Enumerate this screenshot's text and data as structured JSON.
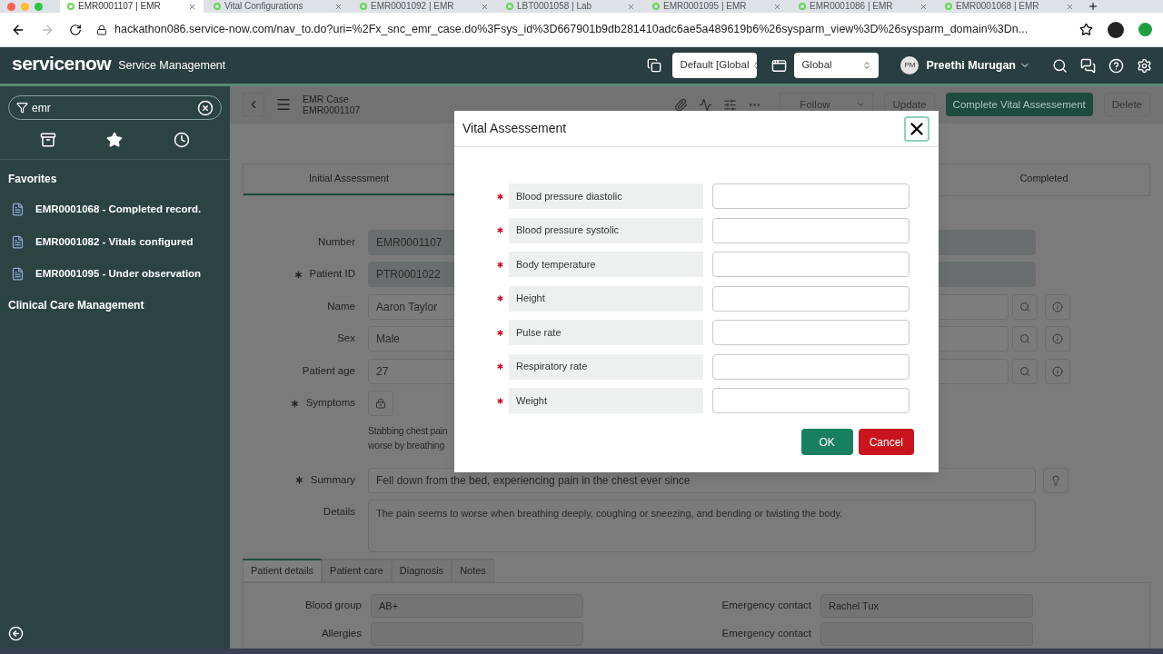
{
  "browser": {
    "tabs": [
      {
        "label": "EMR0001107 | EMR",
        "selected": true
      },
      {
        "label": "Vital Configurations",
        "selected": false
      },
      {
        "label": "EMR0001092 | EMR",
        "selected": false
      },
      {
        "label": "LBT0001058 | Lab",
        "selected": false
      },
      {
        "label": "EMR0001095 | EMR",
        "selected": false
      },
      {
        "label": "EMR0001086 | EMR",
        "selected": false
      },
      {
        "label": "EMR0001068 | EMR",
        "selected": false
      }
    ],
    "url": "hackathon086.service-now.com/nav_to.do?uri=%2Fx_snc_emr_case.do%3Fsys_id%3D667901b9db281410adc6ae5a489619b6%26sysparm_view%3D%26sysparm_domain%3Dn..."
  },
  "header": {
    "logo": "servicenow",
    "app_title": "Service Management",
    "update_set": "Default [Global",
    "scope": "Global",
    "user_initials": "PM",
    "user_name": "Preethi Murugan"
  },
  "sidebar": {
    "filter": "emr",
    "favorites_heading": "Favorites",
    "favorites": [
      "EMR0001068 - Completed record.",
      "EMR0001082 - Vitals configured",
      "EMR0001095 - Under observation"
    ],
    "module": "Clinical Care Management"
  },
  "record": {
    "table": "EMR Case",
    "number": "EMR0001107",
    "actions": [
      {
        "label": "Follow",
        "kind": "split"
      },
      {
        "label": "Update",
        "kind": "plain"
      },
      {
        "label": "Complete Vital Assessement",
        "kind": "primary"
      },
      {
        "label": "Delete",
        "kind": "plain"
      }
    ],
    "stages": [
      {
        "label": "Initial Assessment",
        "selected": true
      },
      {
        "label": "Completed",
        "selected": false
      }
    ],
    "fields": [
      {
        "label": "Number",
        "value": "EMR0001107",
        "required": false,
        "kind": "readonly"
      },
      {
        "label": "Patient ID",
        "value": "PTR0001022",
        "required": true,
        "kind": "readonly"
      },
      {
        "label": "Name",
        "value": "Aaron Taylor",
        "required": false,
        "kind": "reference"
      },
      {
        "label": "Sex",
        "value": "Male",
        "required": false,
        "kind": "reference"
      },
      {
        "label": "Patient age",
        "value": "27",
        "required": false,
        "kind": "reference"
      },
      {
        "label": "Symptoms",
        "required": true,
        "kind": "locked",
        "lines": [
          "Stabbing chest pain",
          "worse by breathing"
        ]
      },
      {
        "label": "Summary",
        "value": "Fell down from the bed, experiencing pain in the chest ever since",
        "required": true,
        "kind": "suggest"
      },
      {
        "label": "Details",
        "value": "The pain seems to worse when breathing deeply, coughing or sneezing, and bending or twisting the body.",
        "required": false,
        "kind": "textarea"
      }
    ],
    "tabs": [
      {
        "label": "Patient details",
        "selected": true
      },
      {
        "label": "Patient care",
        "selected": false
      },
      {
        "label": "Diagnosis",
        "selected": false
      },
      {
        "label": "Notes",
        "selected": false
      }
    ],
    "detail_fields": [
      {
        "label": "Blood group",
        "value": "AB+"
      },
      {
        "label": "Emergency contact",
        "value": "Rachel Tux"
      },
      {
        "label": "Allergies"
      },
      {
        "label": "Emergency contact"
      }
    ]
  },
  "modal": {
    "title": "Vital Assessement",
    "fields": [
      {
        "label": "Blood pressure diastolic",
        "required": true
      },
      {
        "label": "Blood pressure systolic",
        "required": true
      },
      {
        "label": "Body temperature",
        "required": true
      },
      {
        "label": "Height",
        "required": true
      },
      {
        "label": "Pulse rate",
        "required": true
      },
      {
        "label": "Respiratory rate",
        "required": true
      },
      {
        "label": "Weight",
        "required": true
      }
    ],
    "buttons": [
      {
        "label": "OK",
        "kind": "primary"
      },
      {
        "label": "Cancel",
        "kind": "danger"
      }
    ]
  }
}
